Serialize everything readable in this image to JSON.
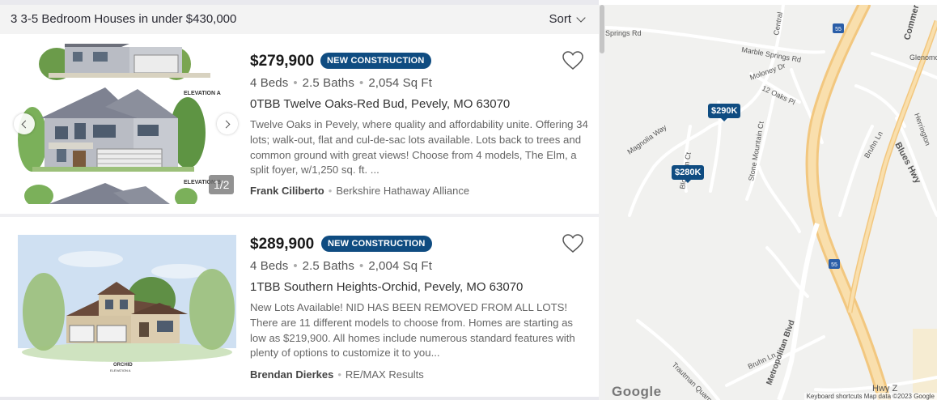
{
  "results": {
    "title": "3 3-5 Bedroom Houses in under $430,000",
    "sort_label": "Sort"
  },
  "listings": [
    {
      "price": "$279,900",
      "badge": "NEW CONSTRUCTION",
      "beds": "4 Beds",
      "baths": "2.5 Baths",
      "sqft": "2,054 Sq Ft",
      "address": "0TBB Twelve Oaks-Red Bud, Pevely, MO 63070",
      "description": "Twelve Oaks in Pevely, where quality and affordability unite. Offering 34 lots; walk-out, flat and cul-de-sac lots available. Lots back to trees and common ground with great views! Choose from 4 models, The Elm, a split foyer, w/1,250 sq. ft. ...",
      "agent": "Frank Ciliberto",
      "brokerage": "Berkshire Hathaway Alliance",
      "photo_counter": "1/2",
      "photo_labels": [
        "ELEVATION A",
        "ELEVATION B"
      ]
    },
    {
      "price": "$289,900",
      "badge": "NEW CONSTRUCTION",
      "beds": "4 Beds",
      "baths": "2.5 Baths",
      "sqft": "2,004 Sq Ft",
      "address": "1TBB Southern Heights-Orchid, Pevely, MO 63070",
      "description": "New Lots Available! NID HAS BEEN REMOVED FROM ALL LOTS! There are 11 different models to choose from. Homes are starting as low as $219,900. All homes include numerous standard features with plenty of options to customize it to you...",
      "agent": "Brendan Dierkes",
      "brokerage": "RE/MAX Results",
      "photo_labels": [
        "ORCHID",
        "ELEVATION A"
      ]
    }
  ],
  "map": {
    "pins": [
      {
        "label": "$290K"
      },
      {
        "label": "$280K"
      }
    ],
    "streets": [
      "Springs Rd",
      "Marble Springs Rd",
      "Central",
      "Moloney Dr",
      "12 Oaks Pl",
      "Magnolia Way",
      "Blossom Ct",
      "Stone Mountain Ct",
      "Bruhn Ln",
      "Blues Hwy",
      "Herrington",
      "Glenomo",
      "Metropolitan Blvd",
      "Trautman Quarry",
      "Hwy Z",
      "Commerce"
    ],
    "route_shield": "55",
    "attribution": "Keyboard shortcuts   Map data ©2023 Google",
    "logo": "Google"
  },
  "colors": {
    "badge": "#0f4c81",
    "highway": "#f7d9a2"
  }
}
